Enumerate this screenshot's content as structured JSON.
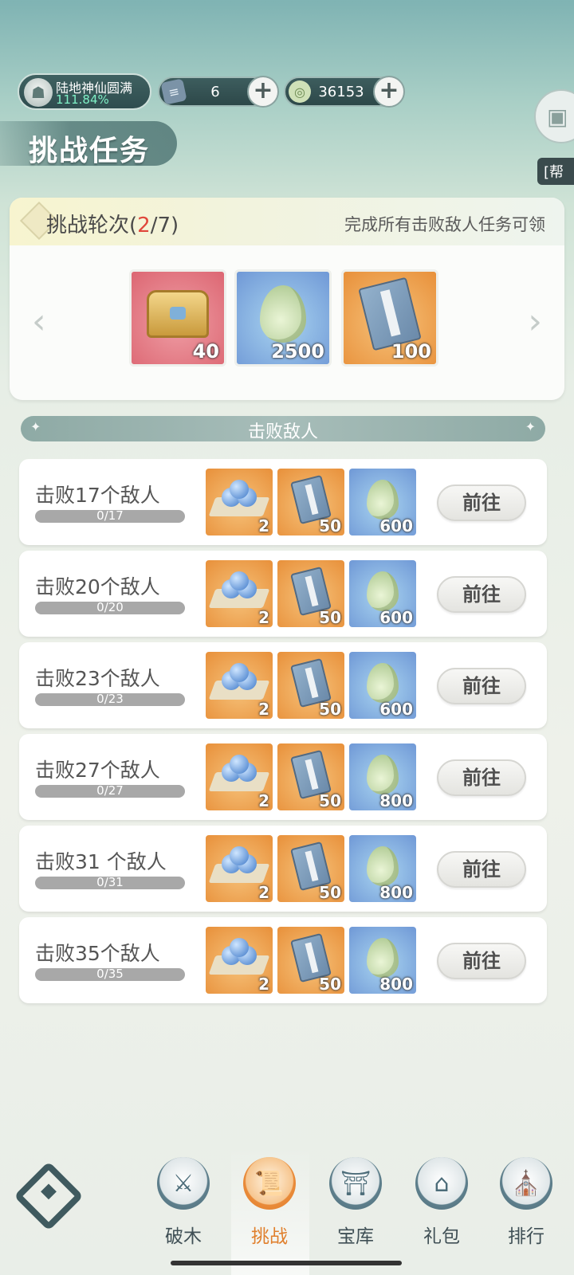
{
  "header": {
    "rank_name": "陆地神仙圆满",
    "rank_percent": "111.84%",
    "scroll_count": "6",
    "jade_count": "36153",
    "side_tag": "[帮"
  },
  "page": {
    "title": "挑战任务"
  },
  "round": {
    "label": "挑战轮次(",
    "current": "2",
    "total_suffix": "/7)",
    "hint": "完成所有击败敌人任务可领",
    "rewards": [
      {
        "icon": "treasure-chest-icon",
        "count": "40"
      },
      {
        "icon": "jade-icon",
        "count": "2500"
      },
      {
        "icon": "scroll-book-icon",
        "count": "100"
      }
    ]
  },
  "section": {
    "title": "击败敌人"
  },
  "tasks": [
    {
      "label": "击败17个敌人",
      "progress": "0/17",
      "rewards": [
        "2",
        "50",
        "600"
      ],
      "button": "前往"
    },
    {
      "label": "击败20个敌人",
      "progress": "0/20",
      "rewards": [
        "2",
        "50",
        "600"
      ],
      "button": "前往"
    },
    {
      "label": "击败23个敌人",
      "progress": "0/23",
      "rewards": [
        "2",
        "50",
        "600"
      ],
      "button": "前往"
    },
    {
      "label": "击败27个敌人",
      "progress": "0/27",
      "rewards": [
        "2",
        "50",
        "800"
      ],
      "button": "前往"
    },
    {
      "label": "击败31 个敌人",
      "progress": "0/31",
      "rewards": [
        "2",
        "50",
        "800"
      ],
      "button": "前往"
    },
    {
      "label": "击败35个敌人",
      "progress": "0/35",
      "rewards": [
        "2",
        "50",
        "800"
      ],
      "button": "前往"
    }
  ],
  "reward_icons": [
    "pellet-icon",
    "scroll-book-icon",
    "jade-icon"
  ],
  "nav": [
    {
      "label": "破木",
      "icon": "breaking-wood-icon",
      "active": false
    },
    {
      "label": "挑战",
      "icon": "challenge-scroll-icon",
      "active": true
    },
    {
      "label": "宝库",
      "icon": "treasury-icon",
      "active": false
    },
    {
      "label": "礼包",
      "icon": "gift-pack-icon",
      "active": false
    },
    {
      "label": "排行",
      "icon": "ranking-icon",
      "active": false
    }
  ],
  "colors": {
    "accent": "#e07f2c",
    "highlight": "#e0463b"
  }
}
